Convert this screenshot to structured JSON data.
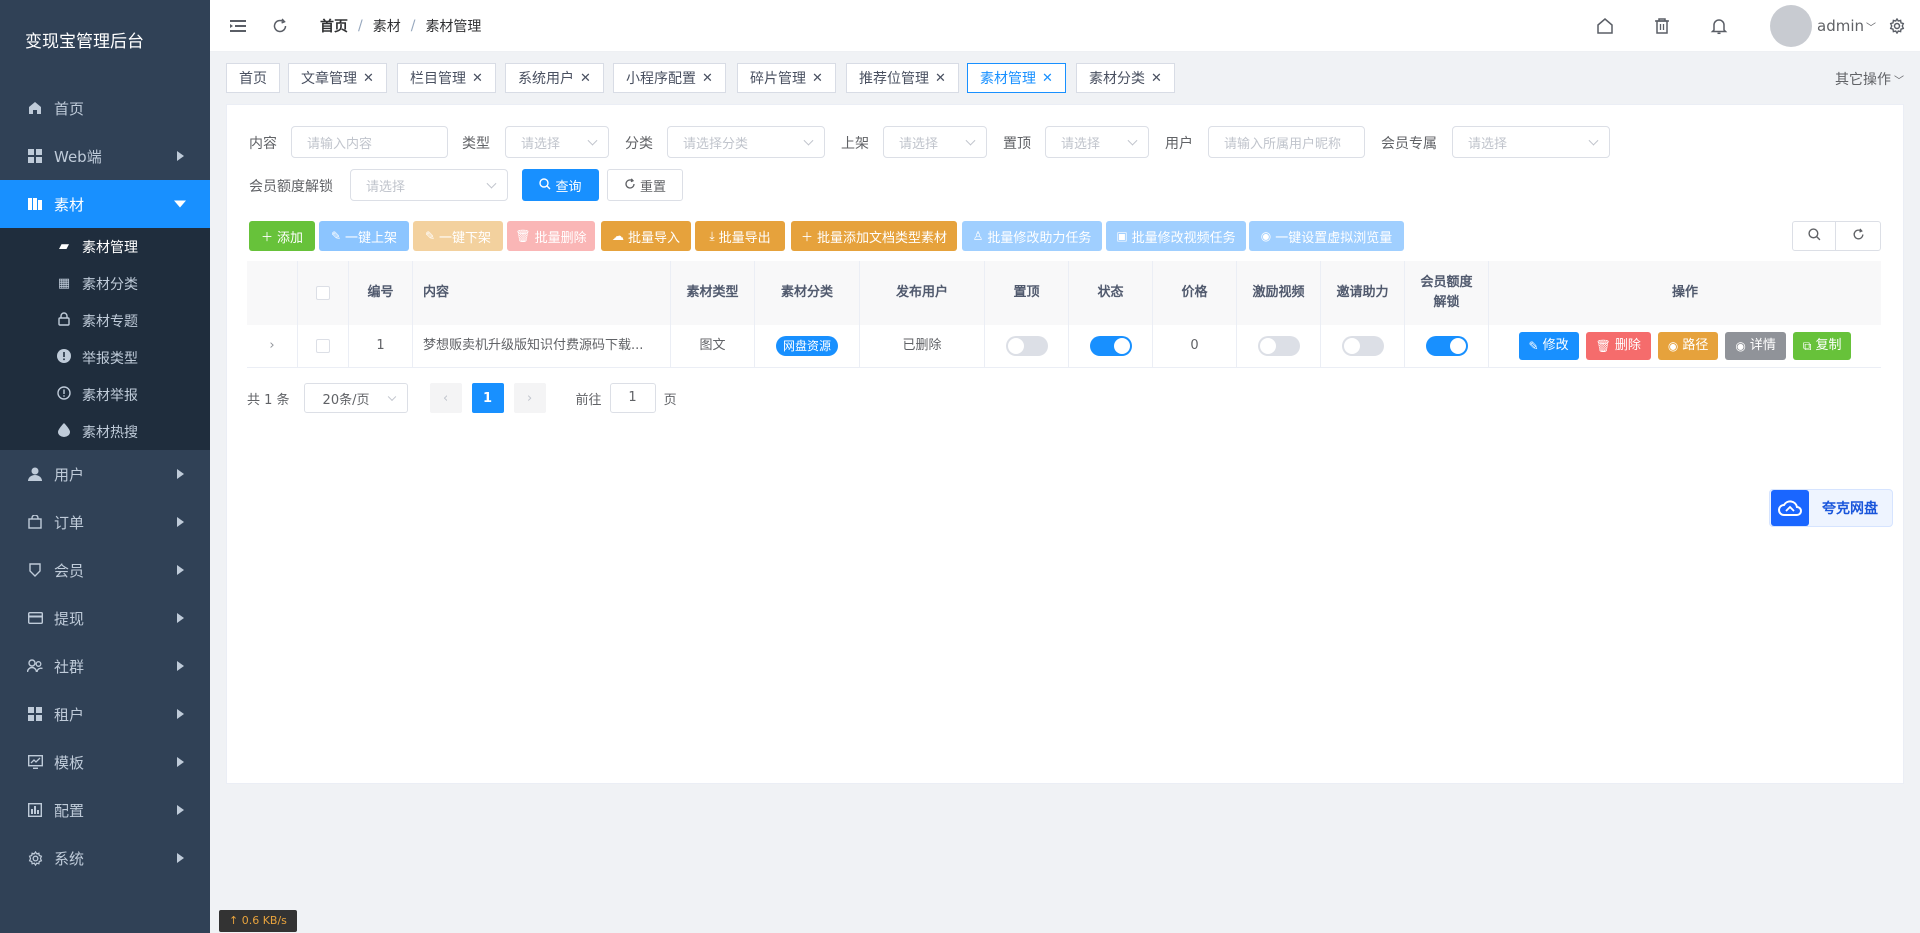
{
  "sidebar": {
    "title": "变现宝管理后台",
    "items": [
      {
        "label": "首页",
        "icon": "home-icon",
        "arrow": false
      },
      {
        "label": "Web端",
        "icon": "grid-icon",
        "arrow": true
      },
      {
        "label": "素材",
        "icon": "material-icon",
        "arrow": true,
        "active": true
      },
      {
        "label": "用户",
        "icon": "user-icon",
        "arrow": true
      },
      {
        "label": "订单",
        "icon": "bag-icon",
        "arrow": true
      },
      {
        "label": "会员",
        "icon": "badge-icon",
        "arrow": true
      },
      {
        "label": "提现",
        "icon": "card-icon",
        "arrow": true
      },
      {
        "label": "社群",
        "icon": "group-icon",
        "arrow": true
      },
      {
        "label": "租户",
        "icon": "grid-icon",
        "arrow": true
      },
      {
        "label": "模板",
        "icon": "chart-icon",
        "arrow": true
      },
      {
        "label": "配置",
        "icon": "bar-chart-icon",
        "arrow": true
      },
      {
        "label": "系统",
        "icon": "gear-icon",
        "arrow": true
      }
    ],
    "sub_items": [
      {
        "label": "素材管理",
        "icon": "material-icon",
        "active": true
      },
      {
        "label": "素材分类",
        "icon": "grid-icon"
      },
      {
        "label": "素材专题",
        "icon": "lock-icon"
      },
      {
        "label": "举报类型",
        "icon": "alert-icon"
      },
      {
        "label": "素材举报",
        "icon": "info-icon"
      },
      {
        "label": "素材热搜",
        "icon": "drop-icon"
      }
    ],
    "speed": "↑ 0.6 KB/s"
  },
  "navbar": {
    "breadcrumb": [
      "首页",
      "素材",
      "素材管理"
    ],
    "user": "admin"
  },
  "tags": [
    {
      "label": "首页",
      "closable": false
    },
    {
      "label": "文章管理",
      "closable": true
    },
    {
      "label": "栏目管理",
      "closable": true
    },
    {
      "label": "系统用户",
      "closable": true
    },
    {
      "label": "小程序配置",
      "closable": true
    },
    {
      "label": "碎片管理",
      "closable": true
    },
    {
      "label": "推荐位管理",
      "closable": true
    },
    {
      "label": "素材管理",
      "closable": true,
      "active": true
    },
    {
      "label": "素材分类",
      "closable": true
    }
  ],
  "other_ops": "其它操作",
  "filters": {
    "content_label": "内容",
    "content_ph": "请输入内容",
    "type_label": "类型",
    "type_ph": "请选择",
    "category_label": "分类",
    "category_ph": "请选择分类",
    "shelf_label": "上架",
    "shelf_ph": "请选择",
    "top_label": "置顶",
    "top_ph": "请选择",
    "user_label": "用户",
    "user_ph": "请输入所属用户昵称",
    "vip_label": "会员专属",
    "vip_ph": "请选择",
    "quota_label": "会员额度解锁",
    "quota_ph": "请选择",
    "query": "查询",
    "reset": "重置"
  },
  "toolbar": {
    "add": "添加",
    "shelf_up": "一键上架",
    "shelf_down": "一键下架",
    "batch_delete": "批量删除",
    "batch_import": "批量导入",
    "batch_export": "批量导出",
    "batch_add_doc": "批量添加文档类型素材",
    "batch_assist": "批量修改助力任务",
    "batch_video": "批量修改视频任务",
    "set_views": "一键设置虚拟浏览量"
  },
  "table": {
    "headers": [
      "编号",
      "内容",
      "素材类型",
      "素材分类",
      "发布用户",
      "置顶",
      "状态",
      "价格",
      "激励视频",
      "邀请助力",
      "会员额度解锁",
      "操作"
    ],
    "rows": [
      {
        "id": "1",
        "content": "梦想贩卖机升级版知识付费源码下载...",
        "type": "图文",
        "category": "网盘资源",
        "publisher": "已删除",
        "top": false,
        "status": true,
        "price": "0",
        "reward_video": false,
        "invite": false,
        "vip_quota": true
      }
    ],
    "ops": {
      "edit": "修改",
      "delete": "删除",
      "path": "路径",
      "detail": "详情",
      "copy": "复制"
    }
  },
  "pager": {
    "total": "共 1 条",
    "size": "20条/页",
    "current": "1",
    "goto": "前往",
    "goto_value": "1",
    "page": "页"
  },
  "quark": {
    "label": "夸克网盘"
  },
  "colors": {
    "primary": "#1890ff",
    "success": "#67c23a",
    "warning": "#e6a23c",
    "danger": "#f56c6c",
    "info": "#909399",
    "sidebar_bg": "#304156"
  }
}
